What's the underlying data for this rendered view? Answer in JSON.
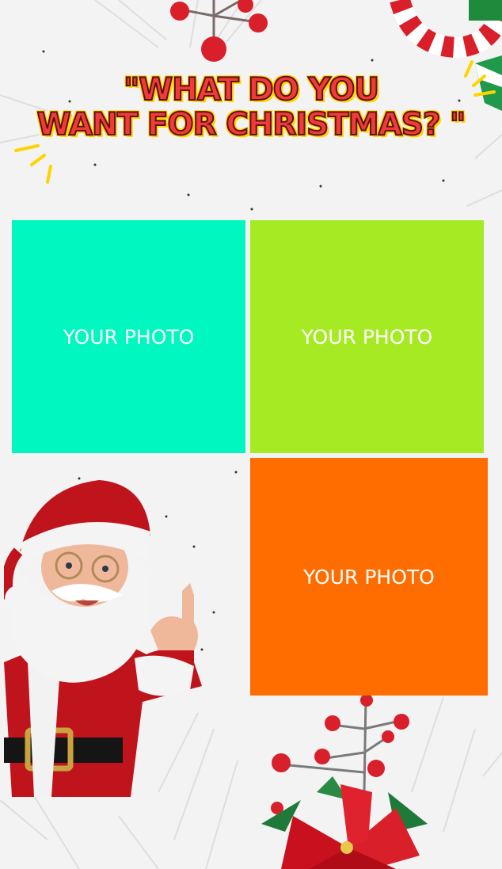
{
  "title": {
    "line1": "\"WHAT DO YOU",
    "line2": "WANT FOR CHRISTMAS? \""
  },
  "photos": [
    {
      "label": "YOUR PHOTO",
      "color": "#00f7c0"
    },
    {
      "label": "YOUR PHOTO",
      "color": "#a6ea24"
    },
    {
      "label": "YOUR PHOTO",
      "color": "#ff6c00"
    }
  ],
  "colors": {
    "title_fill": "#f23a3a",
    "title_outline": "#ffd400",
    "background": "#f3f3f3"
  },
  "decorations": [
    "holly-berries-icon",
    "candy-cane-icon",
    "poinsettia-icon",
    "pine-branches-icon",
    "santa-claus-image"
  ]
}
